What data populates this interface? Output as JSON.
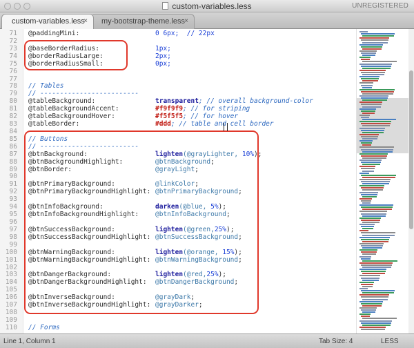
{
  "window": {
    "title": "custom-variables.less",
    "license": "UNREGISTERED"
  },
  "tabs": [
    {
      "label": "custom-variables.less",
      "active": true
    },
    {
      "label": "my-bootstrap-theme.less",
      "active": false
    }
  ],
  "tab_close_glyph": "×",
  "status": {
    "position": "Line 1, Column 1",
    "tab_size": "Tab Size: 4",
    "syntax": "LESS"
  },
  "colors": {
    "highlight": "#e0382b",
    "keyword": "#1a1a9c",
    "variable": "#3c78a8",
    "comment": "#2f6ac0",
    "color_literal": "#c0170f"
  },
  "lines": [
    {
      "n": "71",
      "parts": [
        {
          "text": "@paddingMini:",
          "c": "t"
        },
        {
          "text": "0 6px;  // 22px",
          "c": "num"
        }
      ]
    },
    {
      "n": "72",
      "parts": []
    },
    {
      "n": "73",
      "parts": [
        {
          "text": "@baseBorderRadius:",
          "c": "t"
        },
        {
          "text": "1px;",
          "c": "num"
        }
      ]
    },
    {
      "n": "74",
      "parts": [
        {
          "text": "@borderRadiusLarge:",
          "c": "t"
        },
        {
          "text": "2px;",
          "c": "num"
        }
      ]
    },
    {
      "n": "75",
      "parts": [
        {
          "text": "@borderRadiusSmall:",
          "c": "t"
        },
        {
          "text": "0px;",
          "c": "num"
        }
      ]
    },
    {
      "n": "76",
      "parts": []
    },
    {
      "n": "77",
      "parts": []
    },
    {
      "n": "78",
      "parts": [
        {
          "text": "// Tables",
          "c": "comment"
        }
      ]
    },
    {
      "n": "79",
      "parts": [
        {
          "text": "// -------------------------",
          "c": "comment"
        }
      ]
    },
    {
      "n": "80",
      "parts": [
        {
          "text": "@tableBackground:",
          "c": "t"
        },
        {
          "text": "transparent",
          "c": "kw"
        },
        {
          "text": "; // overall background-color",
          "c": "comment"
        }
      ]
    },
    {
      "n": "81",
      "parts": [
        {
          "text": "@tableBackgroundAccent:",
          "c": "t"
        },
        {
          "text": "#f9f9f9",
          "c": "col-red"
        },
        {
          "text": "; // for striping",
          "c": "comment"
        }
      ]
    },
    {
      "n": "82",
      "parts": [
        {
          "text": "@tableBackgroundHover:",
          "c": "t"
        },
        {
          "text": "#f5f5f5",
          "c": "col-red"
        },
        {
          "text": "; // for hover",
          "c": "comment"
        }
      ]
    },
    {
      "n": "83",
      "parts": [
        {
          "text": "@tableBorder:",
          "c": "t"
        },
        {
          "text": "#ddd",
          "c": "col-red"
        },
        {
          "text": "; // table and cell border",
          "c": "comment"
        }
      ]
    },
    {
      "n": "84",
      "parts": []
    },
    {
      "n": "85",
      "parts": [
        {
          "text": "// Buttons",
          "c": "comment"
        }
      ]
    },
    {
      "n": "86",
      "parts": [
        {
          "text": "// -------------------------",
          "c": "comment"
        }
      ]
    },
    {
      "n": "87",
      "parts": [
        {
          "text": "@btnBackground:",
          "c": "t"
        },
        {
          "text": "lighten",
          "c": "kw"
        },
        {
          "text": "(@grayLighter, ",
          "c": "var"
        },
        {
          "text": "10%",
          "c": "num"
        },
        {
          "text": ");",
          "c": "punct"
        }
      ]
    },
    {
      "n": "88",
      "parts": [
        {
          "text": "@btnBackgroundHighlight:",
          "c": "t"
        },
        {
          "text": "@btnBackground",
          "c": "var"
        },
        {
          "text": ";",
          "c": "punct"
        }
      ]
    },
    {
      "n": "89",
      "parts": [
        {
          "text": "@btnBorder:",
          "c": "t"
        },
        {
          "text": "@grayLight",
          "c": "var"
        },
        {
          "text": ";",
          "c": "punct"
        }
      ]
    },
    {
      "n": "90",
      "parts": []
    },
    {
      "n": "91",
      "parts": [
        {
          "text": "@btnPrimaryBackground:",
          "c": "t"
        },
        {
          "text": "@linkColor",
          "c": "var"
        },
        {
          "text": ";",
          "c": "punct"
        }
      ]
    },
    {
      "n": "92",
      "parts": [
        {
          "text": "@btnPrimaryBackgroundHighlight:",
          "c": "t"
        },
        {
          "text": "@btnPrimaryBackground",
          "c": "var"
        },
        {
          "text": ";",
          "c": "punct"
        }
      ]
    },
    {
      "n": "93",
      "parts": []
    },
    {
      "n": "94",
      "parts": [
        {
          "text": "@btnInfoBackground:",
          "c": "t"
        },
        {
          "text": "darken",
          "c": "kw"
        },
        {
          "text": "(@blue, ",
          "c": "var"
        },
        {
          "text": "5%",
          "c": "num"
        },
        {
          "text": ");",
          "c": "punct"
        }
      ]
    },
    {
      "n": "95",
      "parts": [
        {
          "text": "@btnInfoBackgroundHighlight:",
          "c": "t"
        },
        {
          "text": "@btnInfoBackground",
          "c": "var"
        },
        {
          "text": ";",
          "c": "punct"
        }
      ]
    },
    {
      "n": "96",
      "parts": []
    },
    {
      "n": "97",
      "parts": [
        {
          "text": "@btnSuccessBackground:",
          "c": "t"
        },
        {
          "text": "lighten",
          "c": "kw"
        },
        {
          "text": "(@green,",
          "c": "var"
        },
        {
          "text": "25%",
          "c": "num"
        },
        {
          "text": ");",
          "c": "punct"
        }
      ]
    },
    {
      "n": "98",
      "parts": [
        {
          "text": "@btnSuccessBackgroundHighlight:",
          "c": "t"
        },
        {
          "text": "@btnSuccessBackground",
          "c": "var"
        },
        {
          "text": ";",
          "c": "punct"
        }
      ]
    },
    {
      "n": "99",
      "parts": []
    },
    {
      "n": "100",
      "parts": [
        {
          "text": "@btnWarningBackground:",
          "c": "t"
        },
        {
          "text": "lighten",
          "c": "kw"
        },
        {
          "text": "(@orange, ",
          "c": "var"
        },
        {
          "text": "15%",
          "c": "num"
        },
        {
          "text": ");",
          "c": "punct"
        }
      ]
    },
    {
      "n": "101",
      "parts": [
        {
          "text": "@btnWarningBackgroundHighlight:",
          "c": "t"
        },
        {
          "text": "@btnWarningBackground",
          "c": "var"
        },
        {
          "text": ";",
          "c": "punct"
        }
      ]
    },
    {
      "n": "102",
      "parts": []
    },
    {
      "n": "103",
      "parts": [
        {
          "text": "@btnDangerBackground:",
          "c": "t"
        },
        {
          "text": "lighten",
          "c": "kw"
        },
        {
          "text": "(@red,",
          "c": "var"
        },
        {
          "text": "25%",
          "c": "num"
        },
        {
          "text": ");",
          "c": "punct"
        }
      ]
    },
    {
      "n": "104",
      "parts": [
        {
          "text": "@btnDangerBackgroundHighlight:",
          "c": "t"
        },
        {
          "text": "@btnDangerBackground",
          "c": "var"
        },
        {
          "text": ";",
          "c": "punct"
        }
      ]
    },
    {
      "n": "105",
      "parts": []
    },
    {
      "n": "106",
      "parts": [
        {
          "text": "@btnInverseBackground:",
          "c": "t"
        },
        {
          "text": "@grayDark",
          "c": "var"
        },
        {
          "text": ";",
          "c": "punct"
        }
      ]
    },
    {
      "n": "107",
      "parts": [
        {
          "text": "@btnInverseBackgroundHighlight:",
          "c": "t"
        },
        {
          "text": "@grayDarker",
          "c": "var"
        },
        {
          "text": ";",
          "c": "punct"
        }
      ]
    },
    {
      "n": "108",
      "parts": []
    },
    {
      "n": "109",
      "parts": []
    },
    {
      "n": "110",
      "parts": [
        {
          "text": "// Forms",
          "c": "comment"
        }
      ]
    }
  ]
}
